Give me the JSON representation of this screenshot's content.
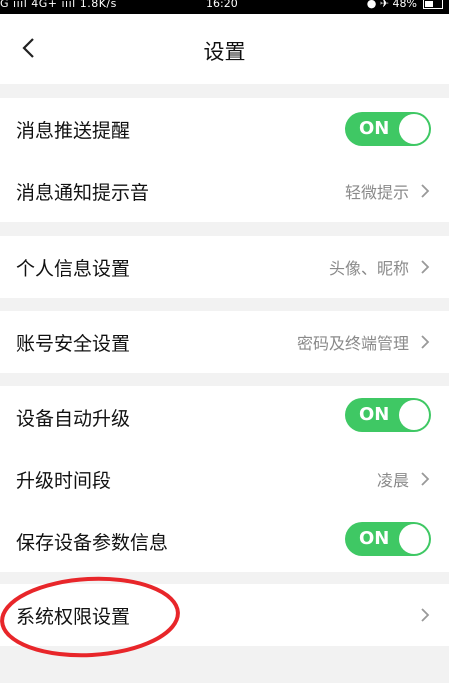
{
  "statusbar": {
    "left": "G ıııl 4G+ ıııl 1.8K/s",
    "time": "16:20",
    "right": "● ✈ 48%"
  },
  "header": {
    "title": "设置"
  },
  "items": {
    "push": {
      "label": "消息推送提醒",
      "toggle": "ON"
    },
    "sound": {
      "label": "消息通知提示音",
      "value": "轻微提示"
    },
    "profile": {
      "label": "个人信息设置",
      "value": "头像、昵称"
    },
    "security": {
      "label": "账号安全设置",
      "value": "密码及终端管理"
    },
    "autoupgrade": {
      "label": "设备自动升级",
      "toggle": "ON"
    },
    "upgradetime": {
      "label": "升级时间段",
      "value": "凌晨"
    },
    "saveparams": {
      "label": "保存设备参数信息",
      "toggle": "ON"
    },
    "permissions": {
      "label": "系统权限设置"
    }
  },
  "colors": {
    "toggle_on": "#3fc864",
    "annotation": "#e8262a",
    "background": "#f2f2f2"
  }
}
